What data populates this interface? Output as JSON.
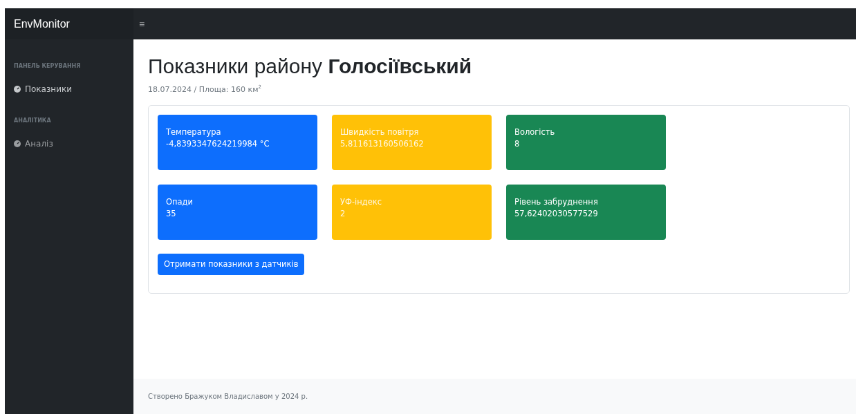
{
  "brand": "EnvMonitor",
  "topbar": {
    "menu_icon": "≡"
  },
  "sidebar": {
    "sections": [
      {
        "heading": "ПАНЕЛЬ КЕРУВАННЯ",
        "items": [
          {
            "label": "Показники",
            "selected": true
          }
        ]
      },
      {
        "heading": "АНАЛІТИКА",
        "items": [
          {
            "label": "Аналіз",
            "selected": false
          }
        ]
      }
    ]
  },
  "page": {
    "title": "Показники району **Голосіївський**",
    "subtitle": "18.07.2024 / Площа: 160 км$^{2}$"
  },
  "metrics": [
    {
      "label": "Температура",
      "value": "-4,8393347624219984 °C",
      "color": "#0d6efd"
    },
    {
      "label": "Швидкість повітря",
      "value": "5,811613160506162",
      "color": "#ffc107"
    },
    {
      "label": "Вологість",
      "value": "8",
      "color": "#198754"
    },
    {
      "label": "Опади",
      "value": "35",
      "color": "#0d6efd"
    },
    {
      "label": "УФ-індекс",
      "value": "2",
      "color": "#ffc107"
    },
    {
      "label": "Рівень забруднення",
      "value": "57,62402030577529",
      "color": "#198754"
    }
  ],
  "fetch_button": "Отримати показники з датчиків",
  "footer": "Створено Бражуком Владиславом у 2024 р."
}
